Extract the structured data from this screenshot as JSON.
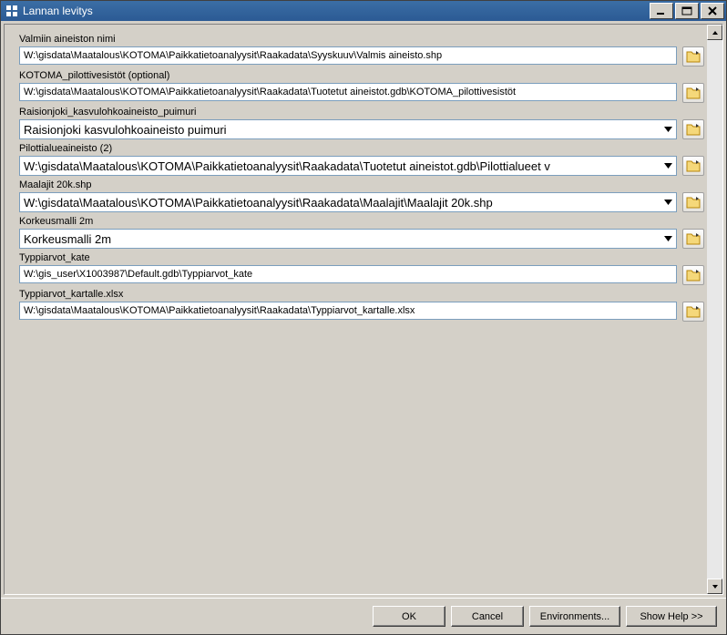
{
  "window": {
    "title": "Lannan levitys"
  },
  "fields": [
    {
      "label": "Valmiin aineiston nimi",
      "type": "text",
      "value": "W:\\gisdata\\Maatalous\\KOTOMA\\Paikkatietoanalyysit\\Raakadata\\Syyskuuv\\Valmis aineisto.shp"
    },
    {
      "label": "KOTOMA_pilottivesistöt (optional)",
      "type": "text",
      "value": "W:\\gisdata\\Maatalous\\KOTOMA\\Paikkatietoanalyysit\\Raakadata\\Tuotetut aineistot.gdb\\KOTOMA_pilottivesistöt"
    },
    {
      "label": "Raisionjoki_kasvulohkoaineisto_puimuri",
      "type": "combo",
      "value": "Raisionjoki kasvulohkoaineisto puimuri"
    },
    {
      "label": "Pilottialueaineisto (2)",
      "type": "combo",
      "value": "W:\\gisdata\\Maatalous\\KOTOMA\\Paikkatietoanalyysit\\Raakadata\\Tuotetut aineistot.gdb\\Pilottialueet v"
    },
    {
      "label": "Maalajit 20k.shp",
      "type": "combo",
      "value": "W:\\gisdata\\Maatalous\\KOTOMA\\Paikkatietoanalyysit\\Raakadata\\Maalajit\\Maalajit 20k.shp"
    },
    {
      "label": "Korkeusmalli 2m",
      "type": "combo",
      "value": "Korkeusmalli 2m"
    },
    {
      "label": "Typpiarvot_kate",
      "type": "text",
      "value": "W:\\gis_user\\X1003987\\Default.gdb\\Typpiarvot_kate"
    },
    {
      "label": "Typpiarvot_kartalle.xlsx",
      "type": "text",
      "value": "W:\\gisdata\\Maatalous\\KOTOMA\\Paikkatietoanalyysit\\Raakadata\\Typpiarvot_kartalle.xlsx"
    }
  ],
  "buttons": {
    "ok": "OK",
    "cancel": "Cancel",
    "environments": "Environments...",
    "showhelp": "Show Help >>"
  }
}
